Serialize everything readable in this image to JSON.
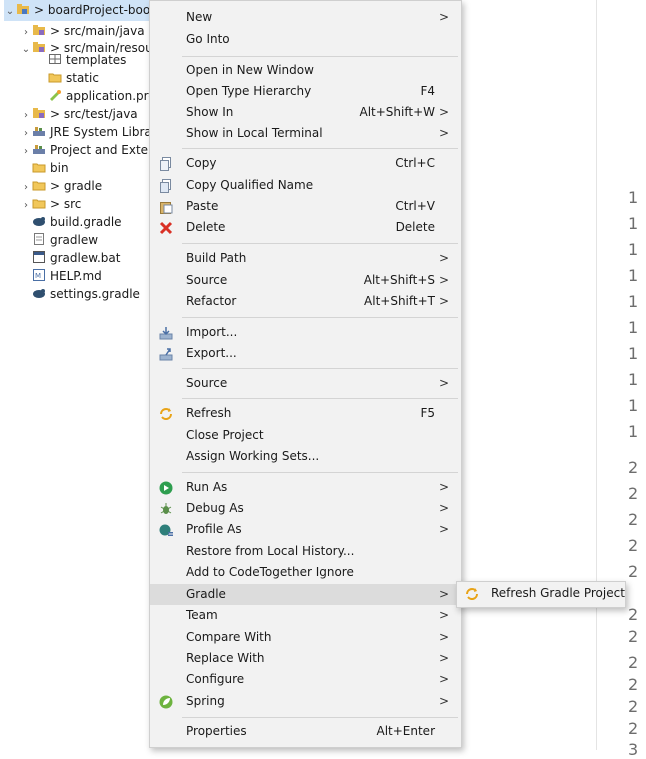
{
  "tree": [
    {
      "label": "> boardProject-boot",
      "chev": "⌄",
      "icon": "project-icon"
    },
    {
      "label": "> src/main/java",
      "chev": "›",
      "icon": "source-folder-icon"
    },
    {
      "label": "> src/main/resour",
      "chev": "⌄",
      "icon": "source-folder-icon"
    },
    {
      "label": "templates",
      "chev": "",
      "icon": "package-icon"
    },
    {
      "label": "static",
      "chev": "",
      "icon": "folder-icon"
    },
    {
      "label": "application.pro",
      "chev": "",
      "icon": "properties-file-icon"
    },
    {
      "label": "> src/test/java",
      "chev": "›",
      "icon": "source-folder-icon"
    },
    {
      "label": "JRE System Library",
      "chev": "›",
      "icon": "library-icon"
    },
    {
      "label": "Project and Extern",
      "chev": "›",
      "icon": "library-icon"
    },
    {
      "label": "bin",
      "chev": "",
      "icon": "folder-icon"
    },
    {
      "label": "> gradle",
      "chev": "›",
      "icon": "folder-icon"
    },
    {
      "label": "> src",
      "chev": "›",
      "icon": "folder-icon"
    },
    {
      "label": "build.gradle",
      "chev": "",
      "icon": "gradle-file-icon"
    },
    {
      "label": "gradlew",
      "chev": "",
      "icon": "file-icon"
    },
    {
      "label": "gradlew.bat",
      "chev": "",
      "icon": "bat-file-icon"
    },
    {
      "label": "HELP.md",
      "chev": "",
      "icon": "markdown-file-icon"
    },
    {
      "label": "settings.gradle",
      "chev": "",
      "icon": "gradle-file-icon"
    }
  ],
  "line_numbers": [
    "1",
    "1",
    "1",
    "1",
    "1",
    "1",
    "1",
    "1",
    "1",
    "1",
    "2",
    "2",
    "2",
    "2",
    "2",
    "2",
    "2",
    "2",
    "2",
    "2",
    "2",
    "3"
  ],
  "menu": {
    "new": "New",
    "go_into": "Go Into",
    "open_new_window": "Open in New Window",
    "open_type_hierarchy": "Open Type Hierarchy",
    "open_type_hierarchy_acc": "F4",
    "show_in": "Show In",
    "show_in_acc": "Alt+Shift+W",
    "show_in_terminal": "Show in Local Terminal",
    "copy": "Copy",
    "copy_acc": "Ctrl+C",
    "copy_qualified": "Copy Qualified Name",
    "paste": "Paste",
    "paste_acc": "Ctrl+V",
    "delete": "Delete",
    "delete_acc": "Delete",
    "build_path": "Build Path",
    "source": "Source",
    "source_acc": "Alt+Shift+S",
    "refactor": "Refactor",
    "refactor_acc": "Alt+Shift+T",
    "import": "Import...",
    "export": "Export...",
    "source2": "Source",
    "refresh": "Refresh",
    "refresh_acc": "F5",
    "close_project": "Close Project",
    "assign_working_sets": "Assign Working Sets...",
    "run_as": "Run As",
    "debug_as": "Debug As",
    "profile_as": "Profile As",
    "restore_history": "Restore from Local History...",
    "add_codetogether": "Add to CodeTogether Ignore",
    "gradle": "Gradle",
    "team": "Team",
    "compare_with": "Compare With",
    "replace_with": "Replace With",
    "configure": "Configure",
    "spring": "Spring",
    "properties": "Properties",
    "properties_acc": "Alt+Enter",
    "arrow": ">"
  },
  "submenu": {
    "refresh_gradle": "Refresh Gradle Project"
  },
  "colors": {
    "menu_bg": "#f2f2f2",
    "highlight": "#dcdcdc",
    "selection": "#cfe3f7",
    "delete_red": "#d93025",
    "run_green": "#2e9e4f",
    "refresh_orange": "#e8a317"
  }
}
